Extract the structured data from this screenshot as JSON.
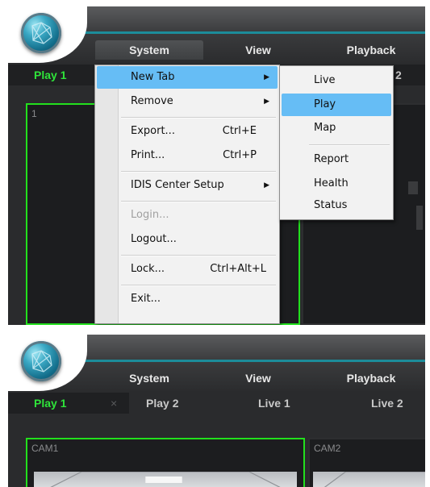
{
  "top": {
    "menubar": {
      "system": "System",
      "view": "View",
      "playback": "Playback"
    },
    "tabs": {
      "play1": "Play 1",
      "play2_partial": "2"
    },
    "cell_label": "1",
    "system_menu": {
      "items": [
        {
          "label": "New Tab",
          "shortcut": "",
          "submenu": true,
          "highlighted": true,
          "disabled": false
        },
        {
          "label": "Remove",
          "shortcut": "",
          "submenu": true,
          "highlighted": false,
          "disabled": false
        },
        {
          "label": "Export...",
          "shortcut": "Ctrl+E",
          "submenu": false,
          "highlighted": false,
          "disabled": false
        },
        {
          "label": "Print...",
          "shortcut": "Ctrl+P",
          "submenu": false,
          "highlighted": false,
          "disabled": false
        },
        {
          "label": "IDIS Center Setup",
          "shortcut": "",
          "submenu": true,
          "highlighted": false,
          "disabled": false
        },
        {
          "label": "Login...",
          "shortcut": "",
          "submenu": false,
          "highlighted": false,
          "disabled": true
        },
        {
          "label": "Logout...",
          "shortcut": "",
          "submenu": false,
          "highlighted": false,
          "disabled": false
        },
        {
          "label": "Lock...",
          "shortcut": "Ctrl+Alt+L",
          "submenu": false,
          "highlighted": false,
          "disabled": false
        },
        {
          "label": "Exit...",
          "shortcut": "",
          "submenu": false,
          "highlighted": false,
          "disabled": false
        }
      ],
      "arrow": "▶"
    },
    "newtab_submenu": {
      "items": [
        "Live",
        "Play",
        "Map",
        "Report",
        "Health",
        "Status"
      ],
      "highlighted": "Play"
    }
  },
  "bottom": {
    "menubar": {
      "system": "System",
      "view": "View",
      "playback": "Playback"
    },
    "tabs": {
      "play1": "Play 1",
      "close": "×",
      "play2": "Play 2",
      "live1": "Live 1",
      "live2": "Live 2"
    },
    "cells": {
      "cam1": "CAM1",
      "cam2": "CAM2"
    }
  },
  "colors": {
    "accent": "#1c8c9a",
    "selected_green": "#22e01d",
    "tab_active": "#2fe33a",
    "menu_highlight": "#66bdf5"
  }
}
